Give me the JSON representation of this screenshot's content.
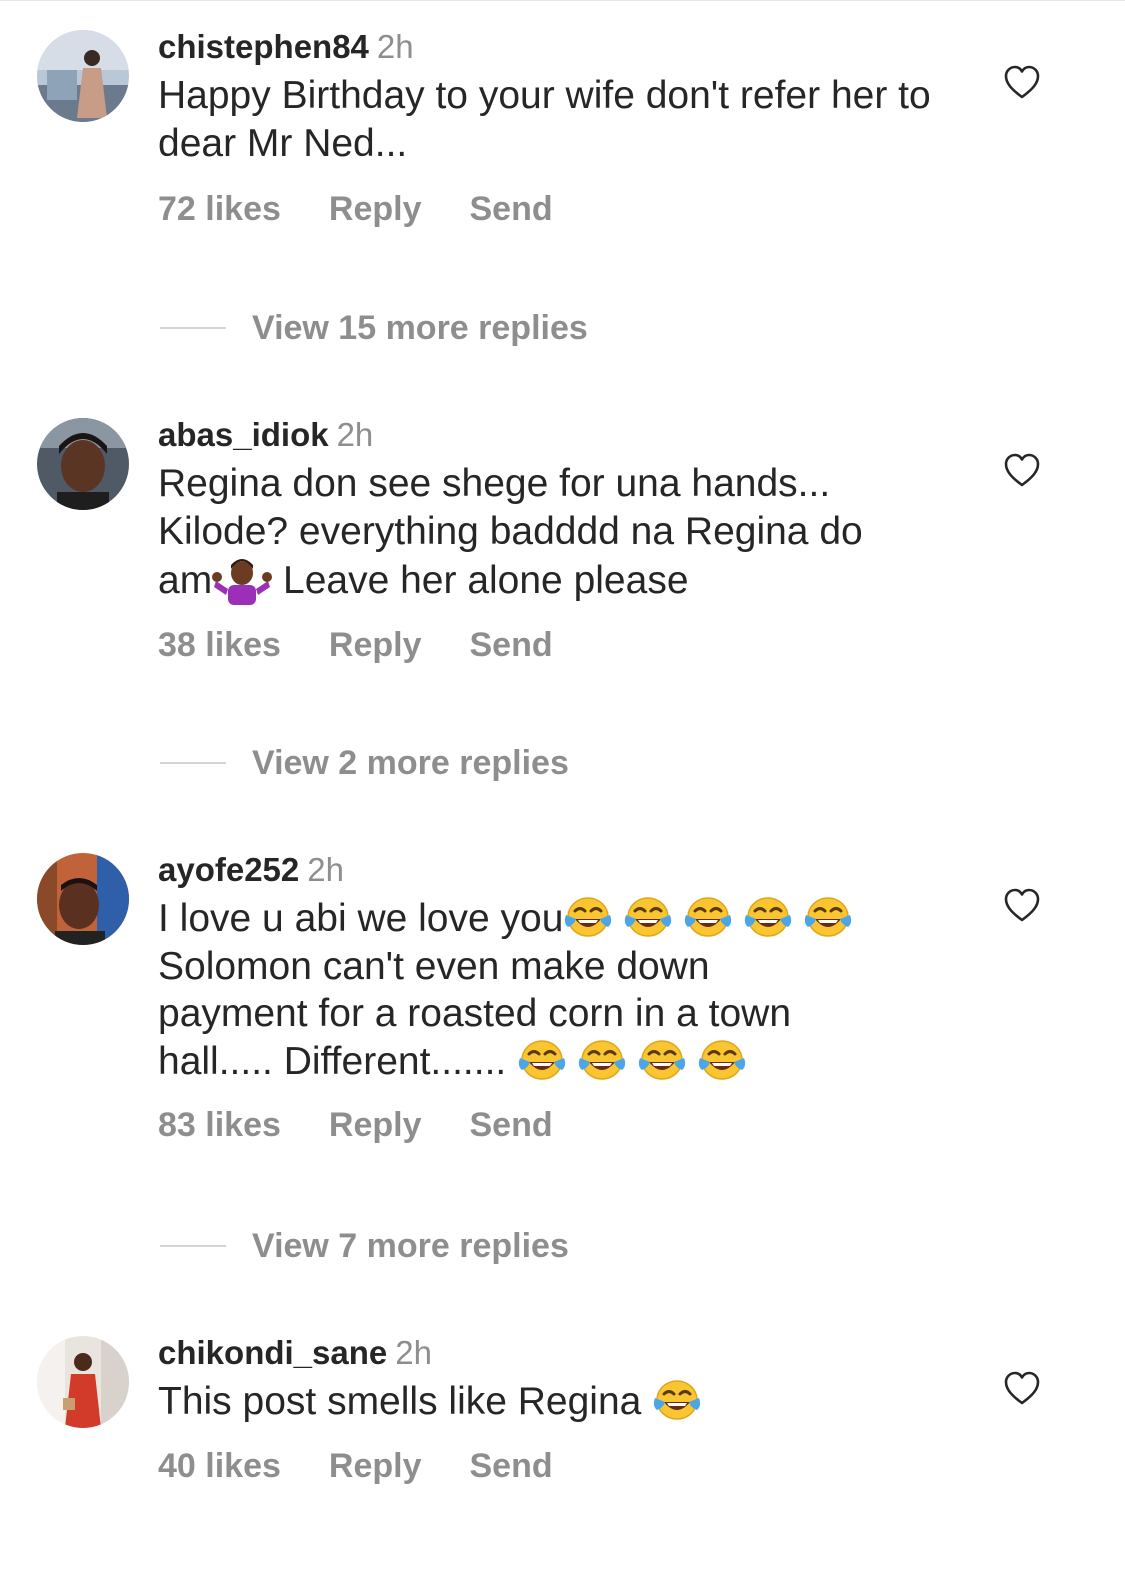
{
  "comments": [
    {
      "username": "chistephen84",
      "time": "2h",
      "text": "Happy Birthday to your wife don't refer her to dear Mr Ned...",
      "likes": "72 likes",
      "reply_label": "Reply",
      "send_label": "Send",
      "view_replies": "View 15 more replies"
    },
    {
      "username": "abas_idiok",
      "time": "2h",
      "text_line1": "Regina don see shege for una hands...",
      "text_line2": "Kilode? everything badddd na Regina do",
      "text_line3a": "am",
      "text_line3b": " Leave her alone please",
      "likes": "38 likes",
      "reply_label": "Reply",
      "send_label": "Send",
      "view_replies": "View 2 more replies"
    },
    {
      "username": "ayofe252",
      "time": "2h",
      "text_line1": "I love u abi we love you",
      "text_line2": "Solomon can't even make down",
      "text_line3": "payment for a roasted corn in a town",
      "text_line4": "hall..... Different....... ",
      "likes": "83 likes",
      "reply_label": "Reply",
      "send_label": "Send",
      "view_replies": "View 7 more replies"
    },
    {
      "username": "chikondi_sane",
      "time": "2h",
      "text": "This post smells like Regina ",
      "likes": "40 likes",
      "reply_label": "Reply",
      "send_label": "Send"
    }
  ],
  "icons": {
    "like": "heart-outline-icon",
    "laugh": "face-with-tears-of-joy-emoji",
    "shrug": "person-shrugging-emoji"
  },
  "colors": {
    "text": "#262626",
    "secondary": "#8e8e8e",
    "divider": "#d4d4d4"
  }
}
